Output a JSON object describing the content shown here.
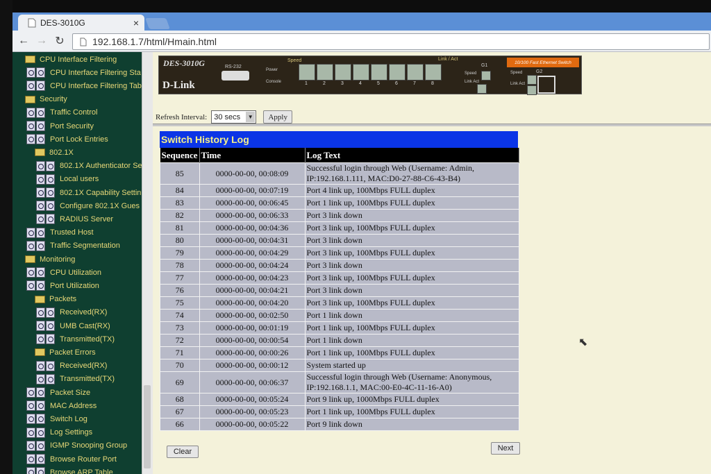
{
  "browser": {
    "tab_title": "DES-3010G",
    "url": "192.168.1.7/html/Hmain.html"
  },
  "sidebar": {
    "items": [
      {
        "label": "CPU Interface Filtering",
        "level": 0,
        "icon": "folder"
      },
      {
        "label": "CPU Interface Filtering Sta",
        "level": 1,
        "icon": "doc"
      },
      {
        "label": "CPU Interface Filtering Tab",
        "level": 1,
        "icon": "doc"
      },
      {
        "label": "Security",
        "level": 0,
        "icon": "folder"
      },
      {
        "label": "Traffic Control",
        "level": 1,
        "icon": "doc"
      },
      {
        "label": "Port Security",
        "level": 1,
        "icon": "doc"
      },
      {
        "label": "Port Lock Entries",
        "level": 1,
        "icon": "doc"
      },
      {
        "label": "802.1X",
        "level": 1,
        "icon": "folder"
      },
      {
        "label": "802.1X Authenticator Se",
        "level": 2,
        "icon": "doc"
      },
      {
        "label": "Local users",
        "level": 2,
        "icon": "doc"
      },
      {
        "label": "802.1X Capability Settin",
        "level": 2,
        "icon": "doc"
      },
      {
        "label": "Configure 802.1X Gues",
        "level": 2,
        "icon": "doc"
      },
      {
        "label": "RADIUS Server",
        "level": 2,
        "icon": "doc"
      },
      {
        "label": "Trusted Host",
        "level": 1,
        "icon": "doc"
      },
      {
        "label": "Traffic Segmentation",
        "level": 1,
        "icon": "doc"
      },
      {
        "label": "Monitoring",
        "level": 0,
        "icon": "folder"
      },
      {
        "label": "CPU Utilization",
        "level": 1,
        "icon": "doc"
      },
      {
        "label": "Port Utilization",
        "level": 1,
        "icon": "doc"
      },
      {
        "label": "Packets",
        "level": 1,
        "icon": "folder"
      },
      {
        "label": "Received(RX)",
        "level": 2,
        "icon": "doc"
      },
      {
        "label": "UMB Cast(RX)",
        "level": 2,
        "icon": "doc"
      },
      {
        "label": "Transmitted(TX)",
        "level": 2,
        "icon": "doc"
      },
      {
        "label": "Packet Errors",
        "level": 1,
        "icon": "folder"
      },
      {
        "label": "Received(RX)",
        "level": 2,
        "icon": "doc"
      },
      {
        "label": "Transmitted(TX)",
        "level": 2,
        "icon": "doc"
      },
      {
        "label": "Packet Size",
        "level": 1,
        "icon": "doc"
      },
      {
        "label": "MAC Address",
        "level": 1,
        "icon": "doc"
      },
      {
        "label": "Switch Log",
        "level": 1,
        "icon": "doc"
      },
      {
        "label": "Log Settings",
        "level": 1,
        "icon": "doc"
      },
      {
        "label": "IGMP Snooping Group",
        "level": 1,
        "icon": "doc"
      },
      {
        "label": "Browse Router Port",
        "level": 1,
        "icon": "doc"
      },
      {
        "label": "Browse ARP Table",
        "level": 1,
        "icon": "doc"
      }
    ]
  },
  "device": {
    "model": "DES-3010G",
    "brand": "D-Link",
    "rs232_label": "RS-232",
    "power_label": "Power",
    "console_label": "Console",
    "speed_label": "Speed",
    "link_act_label": "Link / Act",
    "g1_label": "G1",
    "g2_label": "G2",
    "speed_small": "Speed",
    "link_act_small": "Link\nAct",
    "badge": "10/100 Fast Ethernet Switch",
    "port_numbers": [
      "1",
      "2",
      "3",
      "4",
      "5",
      "6",
      "7",
      "8"
    ]
  },
  "controls": {
    "refresh_label": "Refresh Interval:",
    "refresh_value": "30 secs",
    "apply_label": "Apply",
    "clear_label": "Clear",
    "next_label": "Next"
  },
  "log": {
    "title": "Switch History Log",
    "headers": [
      "Sequence",
      "Time",
      "Log Text"
    ],
    "rows": [
      {
        "seq": "85",
        "time": "0000-00-00, 00:08:09",
        "text": "Successful login through Web (Username: Admin, IP:192.168.1.111, MAC:D0-27-88-C6-43-B4)"
      },
      {
        "seq": "84",
        "time": "0000-00-00, 00:07:19",
        "text": "Port 4 link up, 100Mbps FULL duplex"
      },
      {
        "seq": "83",
        "time": "0000-00-00, 00:06:45",
        "text": "Port 1 link up, 100Mbps FULL duplex"
      },
      {
        "seq": "82",
        "time": "0000-00-00, 00:06:33",
        "text": "Port 3 link down"
      },
      {
        "seq": "81",
        "time": "0000-00-00, 00:04:36",
        "text": "Port 3 link up, 100Mbps FULL duplex"
      },
      {
        "seq": "80",
        "time": "0000-00-00, 00:04:31",
        "text": "Port 3 link down"
      },
      {
        "seq": "79",
        "time": "0000-00-00, 00:04:29",
        "text": "Port 3 link up, 100Mbps FULL duplex"
      },
      {
        "seq": "78",
        "time": "0000-00-00, 00:04:24",
        "text": "Port 3 link down"
      },
      {
        "seq": "77",
        "time": "0000-00-00, 00:04:23",
        "text": "Port 3 link up, 100Mbps FULL duplex"
      },
      {
        "seq": "76",
        "time": "0000-00-00, 00:04:21",
        "text": "Port 3 link down"
      },
      {
        "seq": "75",
        "time": "0000-00-00, 00:04:20",
        "text": "Port 3 link up, 100Mbps FULL duplex"
      },
      {
        "seq": "74",
        "time": "0000-00-00, 00:02:50",
        "text": "Port 1 link down"
      },
      {
        "seq": "73",
        "time": "0000-00-00, 00:01:19",
        "text": "Port 1 link up, 100Mbps FULL duplex"
      },
      {
        "seq": "72",
        "time": "0000-00-00, 00:00:54",
        "text": "Port 1 link down"
      },
      {
        "seq": "71",
        "time": "0000-00-00, 00:00:26",
        "text": "Port 1 link up, 100Mbps FULL duplex"
      },
      {
        "seq": "70",
        "time": "0000-00-00, 00:00:12",
        "text": "System started up"
      },
      {
        "seq": "69",
        "time": "0000-00-00, 00:06:37",
        "text": "Successful login through Web (Username: Anonymous, IP:192.168.1.1, MAC:00-E0-4C-11-16-A0)"
      },
      {
        "seq": "68",
        "time": "0000-00-00, 00:05:24",
        "text": "Port 9 link up, 1000Mbps FULL duplex"
      },
      {
        "seq": "67",
        "time": "0000-00-00, 00:05:23",
        "text": "Port 1 link up, 100Mbps FULL duplex"
      },
      {
        "seq": "66",
        "time": "0000-00-00, 00:05:22",
        "text": "Port 9 link down"
      }
    ]
  },
  "colors": {
    "sidebar_bg": "#0f3f30",
    "sidebar_text": "#e8d878",
    "content_bg": "#f4f2da",
    "log_title_bg": "#0b35e6",
    "log_title_text": "#f5f08a",
    "row_bg": "#b8bac8",
    "badge_bg": "#e06a10"
  }
}
